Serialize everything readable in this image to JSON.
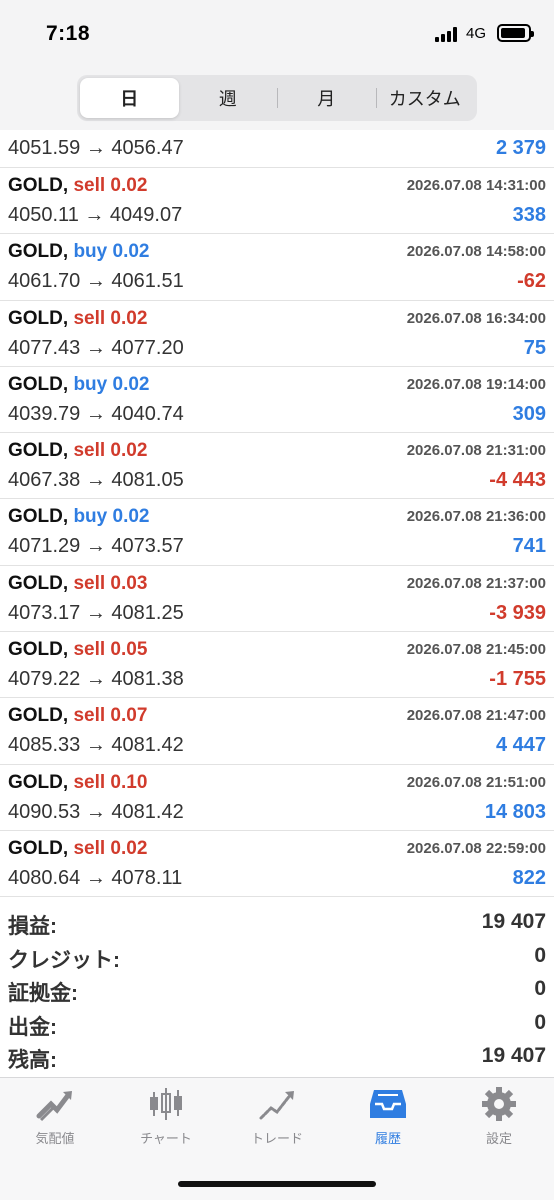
{
  "status_bar": {
    "time": "7:18",
    "network": "4G"
  },
  "period_tabs": [
    {
      "label": "日",
      "active": true
    },
    {
      "label": "週",
      "active": false
    },
    {
      "label": "月",
      "active": false
    },
    {
      "label": "カスタム",
      "active": false
    }
  ],
  "partial_row": {
    "prices": "4051.59 → 4056.47",
    "profit": "2 379"
  },
  "trades": [
    {
      "symbol": "GOLD,",
      "side": "sell 0.02",
      "time": "2026.07.08 14:31:00",
      "prices": "4050.11 → 4049.07",
      "profit": "338"
    },
    {
      "symbol": "GOLD,",
      "side": "buy 0.02",
      "time": "2026.07.08 14:58:00",
      "prices": "4061.70 → 4061.51",
      "profit": "-62"
    },
    {
      "symbol": "GOLD,",
      "side": "sell 0.02",
      "time": "2026.07.08 16:34:00",
      "prices": "4077.43 → 4077.20",
      "profit": "75"
    },
    {
      "symbol": "GOLD,",
      "side": "buy 0.02",
      "time": "2026.07.08 19:14:00",
      "prices": "4039.79 → 4040.74",
      "profit": "309"
    },
    {
      "symbol": "GOLD,",
      "side": "sell 0.02",
      "time": "2026.07.08 21:31:00",
      "prices": "4067.38 → 4081.05",
      "profit": "-4 443"
    },
    {
      "symbol": "GOLD,",
      "side": "buy 0.02",
      "time": "2026.07.08 21:36:00",
      "prices": "4071.29 → 4073.57",
      "profit": "741"
    },
    {
      "symbol": "GOLD,",
      "side": "sell 0.03",
      "time": "2026.07.08 21:37:00",
      "prices": "4073.17 → 4081.25",
      "profit": "-3 939"
    },
    {
      "symbol": "GOLD,",
      "side": "sell 0.05",
      "time": "2026.07.08 21:45:00",
      "prices": "4079.22 → 4081.38",
      "profit": "-1 755"
    },
    {
      "symbol": "GOLD,",
      "side": "sell 0.07",
      "time": "2026.07.08 21:47:00",
      "prices": "4085.33 → 4081.42",
      "profit": "4 447"
    },
    {
      "symbol": "GOLD,",
      "side": "sell 0.10",
      "time": "2026.07.08 21:51:00",
      "prices": "4090.53 → 4081.42",
      "profit": "14 803"
    },
    {
      "symbol": "GOLD,",
      "side": "sell 0.02",
      "time": "2026.07.08 22:59:00",
      "prices": "4080.64 → 4078.11",
      "profit": "822"
    }
  ],
  "summary": [
    {
      "label": "損益:",
      "value": "19 407"
    },
    {
      "label": "クレジット:",
      "value": "0"
    },
    {
      "label": "証拠金:",
      "value": "0"
    },
    {
      "label": "出金:",
      "value": "0"
    },
    {
      "label": "残高:",
      "value": "19 407"
    }
  ],
  "tab_bar": [
    {
      "label": "気配値",
      "icon": "quotes-icon",
      "active": false
    },
    {
      "label": "チャート",
      "icon": "candlestick-icon",
      "active": false
    },
    {
      "label": "トレード",
      "icon": "trade-icon",
      "active": false
    },
    {
      "label": "履歴",
      "icon": "history-inbox-icon",
      "active": true
    },
    {
      "label": "設定",
      "icon": "gear-icon",
      "active": false
    }
  ],
  "colors": {
    "sell": "#d13b2c",
    "buy": "#2f7de1",
    "profit_positive": "#2f7de1",
    "profit_negative": "#d13b2c",
    "active_tab": "#2f7de1",
    "inactive_tab": "#8a8a8e"
  }
}
